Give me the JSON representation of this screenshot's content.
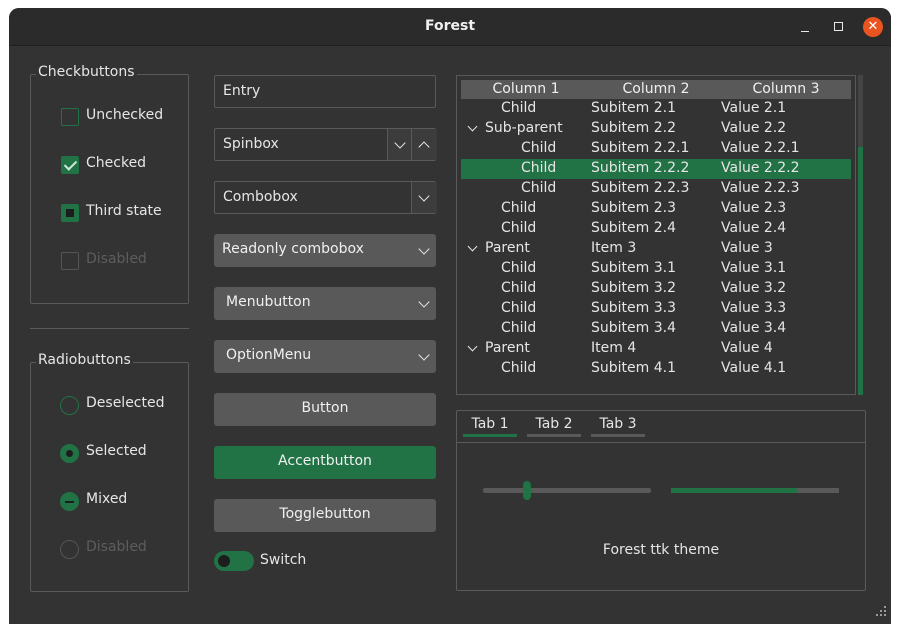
{
  "window": {
    "title": "Forest",
    "close_glyph": "✕"
  },
  "checkbuttons": {
    "label": "Checkbuttons",
    "items": [
      {
        "label": "Unchecked",
        "state": "unchecked"
      },
      {
        "label": "Checked",
        "state": "checked"
      },
      {
        "label": "Third state",
        "state": "third"
      },
      {
        "label": "Disabled",
        "state": "disabled"
      }
    ]
  },
  "radiobuttons": {
    "label": "Radiobuttons",
    "items": [
      {
        "label": "Deselected",
        "state": "deselected"
      },
      {
        "label": "Selected",
        "state": "selected"
      },
      {
        "label": "Mixed",
        "state": "mixed"
      },
      {
        "label": "Disabled",
        "state": "disabled"
      }
    ]
  },
  "widgets": {
    "entry": "Entry",
    "spinbox": "Spinbox",
    "combobox": "Combobox",
    "readonly_combobox": "Readonly combobox",
    "menubutton": "Menubutton",
    "optionmenu": "OptionMenu",
    "button": "Button",
    "accentbutton": "Accentbutton",
    "togglebutton": "Togglebutton",
    "switch": "Switch",
    "switch_on": true
  },
  "treeview": {
    "columns": [
      "Column 1",
      "Column 2",
      "Column 3"
    ],
    "rows": [
      {
        "c1": "Child",
        "c2": "Subitem 2.1",
        "c3": "Value 2.1"
      },
      {
        "c1": "Sub-parent",
        "c2": "Subitem 2.2",
        "c3": "Value 2.2"
      },
      {
        "c1": "Child",
        "c2": "Subitem 2.2.1",
        "c3": "Value 2.2.1"
      },
      {
        "c1": "Child",
        "c2": "Subitem 2.2.2",
        "c3": "Value 2.2.2"
      },
      {
        "c1": "Child",
        "c2": "Subitem 2.2.3",
        "c3": "Value 2.2.3"
      },
      {
        "c1": "Child",
        "c2": "Subitem 2.3",
        "c3": "Value 2.3"
      },
      {
        "c1": "Child",
        "c2": "Subitem 2.4",
        "c3": "Value 2.4"
      },
      {
        "c1": "Parent",
        "c2": "Item 3",
        "c3": "Value 3"
      },
      {
        "c1": "Child",
        "c2": "Subitem 3.1",
        "c3": "Value 3.1"
      },
      {
        "c1": "Child",
        "c2": "Subitem 3.2",
        "c3": "Value 3.2"
      },
      {
        "c1": "Child",
        "c2": "Subitem 3.3",
        "c3": "Value 3.3"
      },
      {
        "c1": "Child",
        "c2": "Subitem 3.4",
        "c3": "Value 3.4"
      },
      {
        "c1": "Parent",
        "c2": "Item 4",
        "c3": "Value 4"
      },
      {
        "c1": "Child",
        "c2": "Subitem 4.1",
        "c3": "Value 4.1"
      }
    ],
    "selected_row": 3
  },
  "notebook": {
    "tabs": [
      "Tab 1",
      "Tab 2",
      "Tab 3"
    ],
    "active_tab": 0,
    "scale_value": 0.26,
    "progress_value": 0.75,
    "label": "Forest ttk theme"
  },
  "colors": {
    "accent": "#217346",
    "background": "#333333"
  }
}
